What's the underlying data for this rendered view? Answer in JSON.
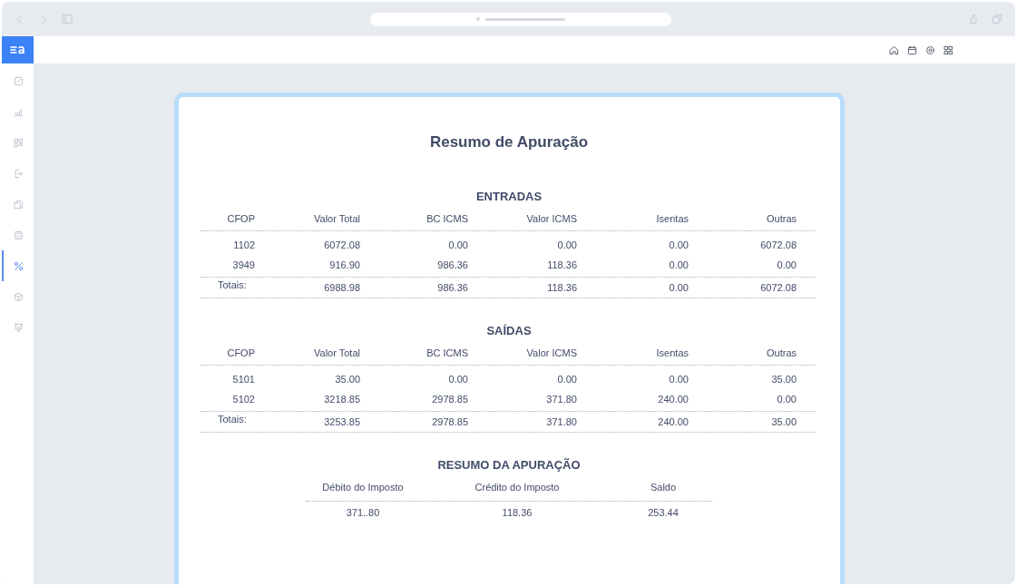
{
  "sidebar": {
    "items": [
      {
        "selected": false
      },
      {
        "selected": false
      },
      {
        "selected": false
      },
      {
        "selected": false
      },
      {
        "selected": false
      },
      {
        "selected": false
      },
      {
        "selected": true
      },
      {
        "selected": false
      },
      {
        "selected": false
      }
    ]
  },
  "report": {
    "title": "Resumo de Apuração",
    "sections": [
      {
        "title": "ENTRADAS",
        "columns": [
          "CFOP",
          "Valor Total",
          "BC ICMS",
          "Valor ICMS",
          "Isentas",
          "Outras"
        ],
        "rows": [
          [
            "1102",
            "6072.08",
            "0.00",
            "0.00",
            "0.00",
            "6072.08"
          ],
          [
            "3949",
            "916.90",
            "986.36",
            "118.36",
            "0.00",
            "0.00"
          ]
        ],
        "totals": [
          "Totais:",
          "6988.98",
          "986.36",
          "118.36",
          "0.00",
          "6072.08"
        ]
      },
      {
        "title": "SAÍDAS",
        "columns": [
          "CFOP",
          "Valor Total",
          "BC ICMS",
          "Valor ICMS",
          "Isentas",
          "Outras"
        ],
        "rows": [
          [
            "5101",
            "35.00",
            "0.00",
            "0.00",
            "0.00",
            "35.00"
          ],
          [
            "5102",
            "3218.85",
            "2978.85",
            "371.80",
            "240.00",
            "0.00"
          ]
        ],
        "totals": [
          "Totais:",
          "3253.85",
          "2978.85",
          "371.80",
          "240.00",
          "35.00"
        ]
      }
    ],
    "summary": {
      "title": "RESUMO DA APURAÇÃO",
      "columns": [
        "Débito do Imposto",
        "Crédito do Imposto",
        "Saldo"
      ],
      "values": [
        "371..80",
        "118.36",
        "253.44"
      ]
    }
  }
}
